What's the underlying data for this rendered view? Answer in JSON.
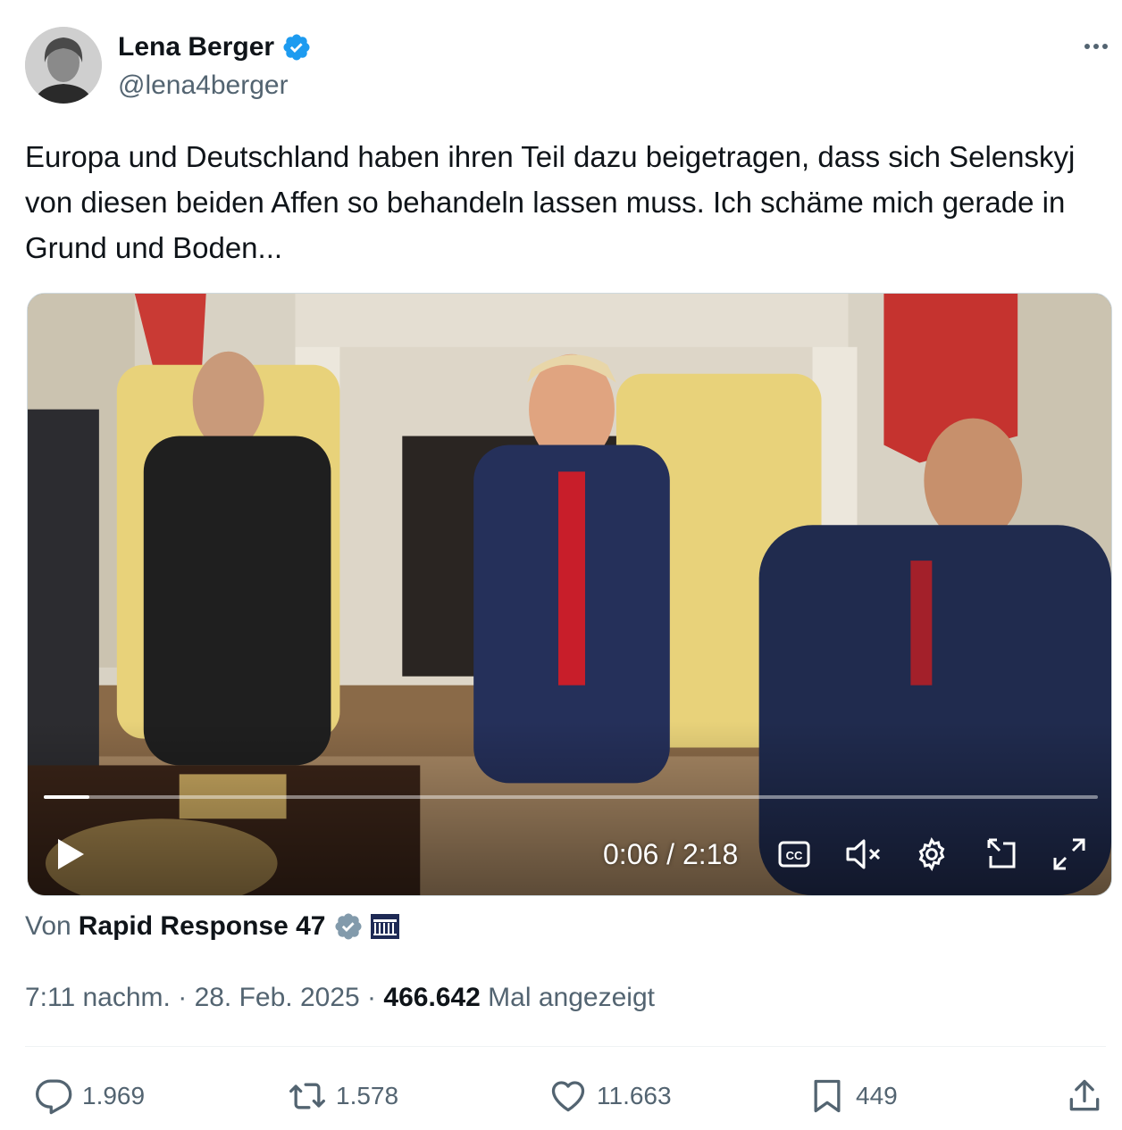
{
  "author": {
    "name": "Lena Berger",
    "handle": "@lena4berger"
  },
  "tweet": {
    "text": "Europa und Deutschland haben ihren Teil dazu beigetragen, dass sich Selenskyj von diesen beiden Affen so behandeln lassen muss. Ich schäme mich gerade in Grund und Boden..."
  },
  "video": {
    "time": "0:06 / 2:18",
    "progress": 0.043,
    "caption_label": "CC"
  },
  "source": {
    "prefix": "Von",
    "name": "Rapid Response 47"
  },
  "meta": {
    "time": "7:11 nachm.",
    "separator1": " · ",
    "date": "28. Feb. 2025",
    "separator2": " · ",
    "views": "466.642",
    "views_label": " Mal angezeigt"
  },
  "actions": {
    "replies": "1.969",
    "reposts": "1.578",
    "likes": "11.663",
    "bookmarks": "449"
  },
  "colors": {
    "verified": "#1d9bf0",
    "text": "#0f1419",
    "muted": "#536471"
  }
}
